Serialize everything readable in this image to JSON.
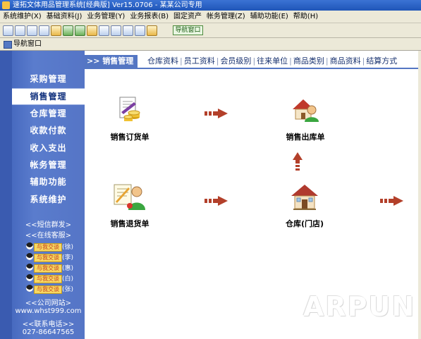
{
  "window": {
    "title": "速拓文体用品管理系统[经典版] Ver15.0706 - 某某公司专用"
  },
  "menubar": [
    "系统维护(X)",
    "基础资料(J)",
    "业务管理(Y)",
    "业务报表(B)",
    "固定资产",
    "帐务管理(Z)",
    "辅助功能(E)",
    "帮助(H)"
  ],
  "toolbar": {
    "nav_button_label": "导航窗口"
  },
  "dock": {
    "title": "导航窗口"
  },
  "sidebar": {
    "items": [
      {
        "label": "采购管理",
        "active": false
      },
      {
        "label": "销售管理",
        "active": true
      },
      {
        "label": "仓库管理",
        "active": false
      },
      {
        "label": "收款付款",
        "active": false
      },
      {
        "label": "收入支出",
        "active": false
      },
      {
        "label": "帐务管理",
        "active": false
      },
      {
        "label": "辅助功能",
        "active": false
      },
      {
        "label": "系统维护",
        "active": false
      }
    ],
    "sms_link": "<<短信群发>",
    "online_service": "<<在线客服>",
    "qq_contacts": [
      {
        "button": "与我交谈",
        "name": "(徐)"
      },
      {
        "button": "与我交谈",
        "name": "(李)"
      },
      {
        "button": "与我交谈",
        "name": "(惠)"
      },
      {
        "button": "与我交谈",
        "name": "(白)"
      },
      {
        "button": "与我交谈",
        "name": "(张)"
      }
    ],
    "website_label": "<<公司网站>",
    "website_url": "www.whst999.com",
    "phone_label": "<<联系电话>>",
    "phone": "027-86647565"
  },
  "header": {
    "title": ">> 销售管理",
    "tabs": [
      "仓库资料",
      "员工资料",
      "会员级别",
      "往来单位",
      "商品类别",
      "商品资料",
      "结算方式"
    ]
  },
  "flow": {
    "sales_order": "销售订货单",
    "sales_outbound": "销售出库单",
    "sales_return": "销售退货单",
    "warehouse": "仓库(门店)"
  },
  "colors": {
    "sidebar": "#5575c6",
    "header_accent": "#5476c3",
    "arrow": "#b3402a"
  },
  "watermark": "ARPUN"
}
